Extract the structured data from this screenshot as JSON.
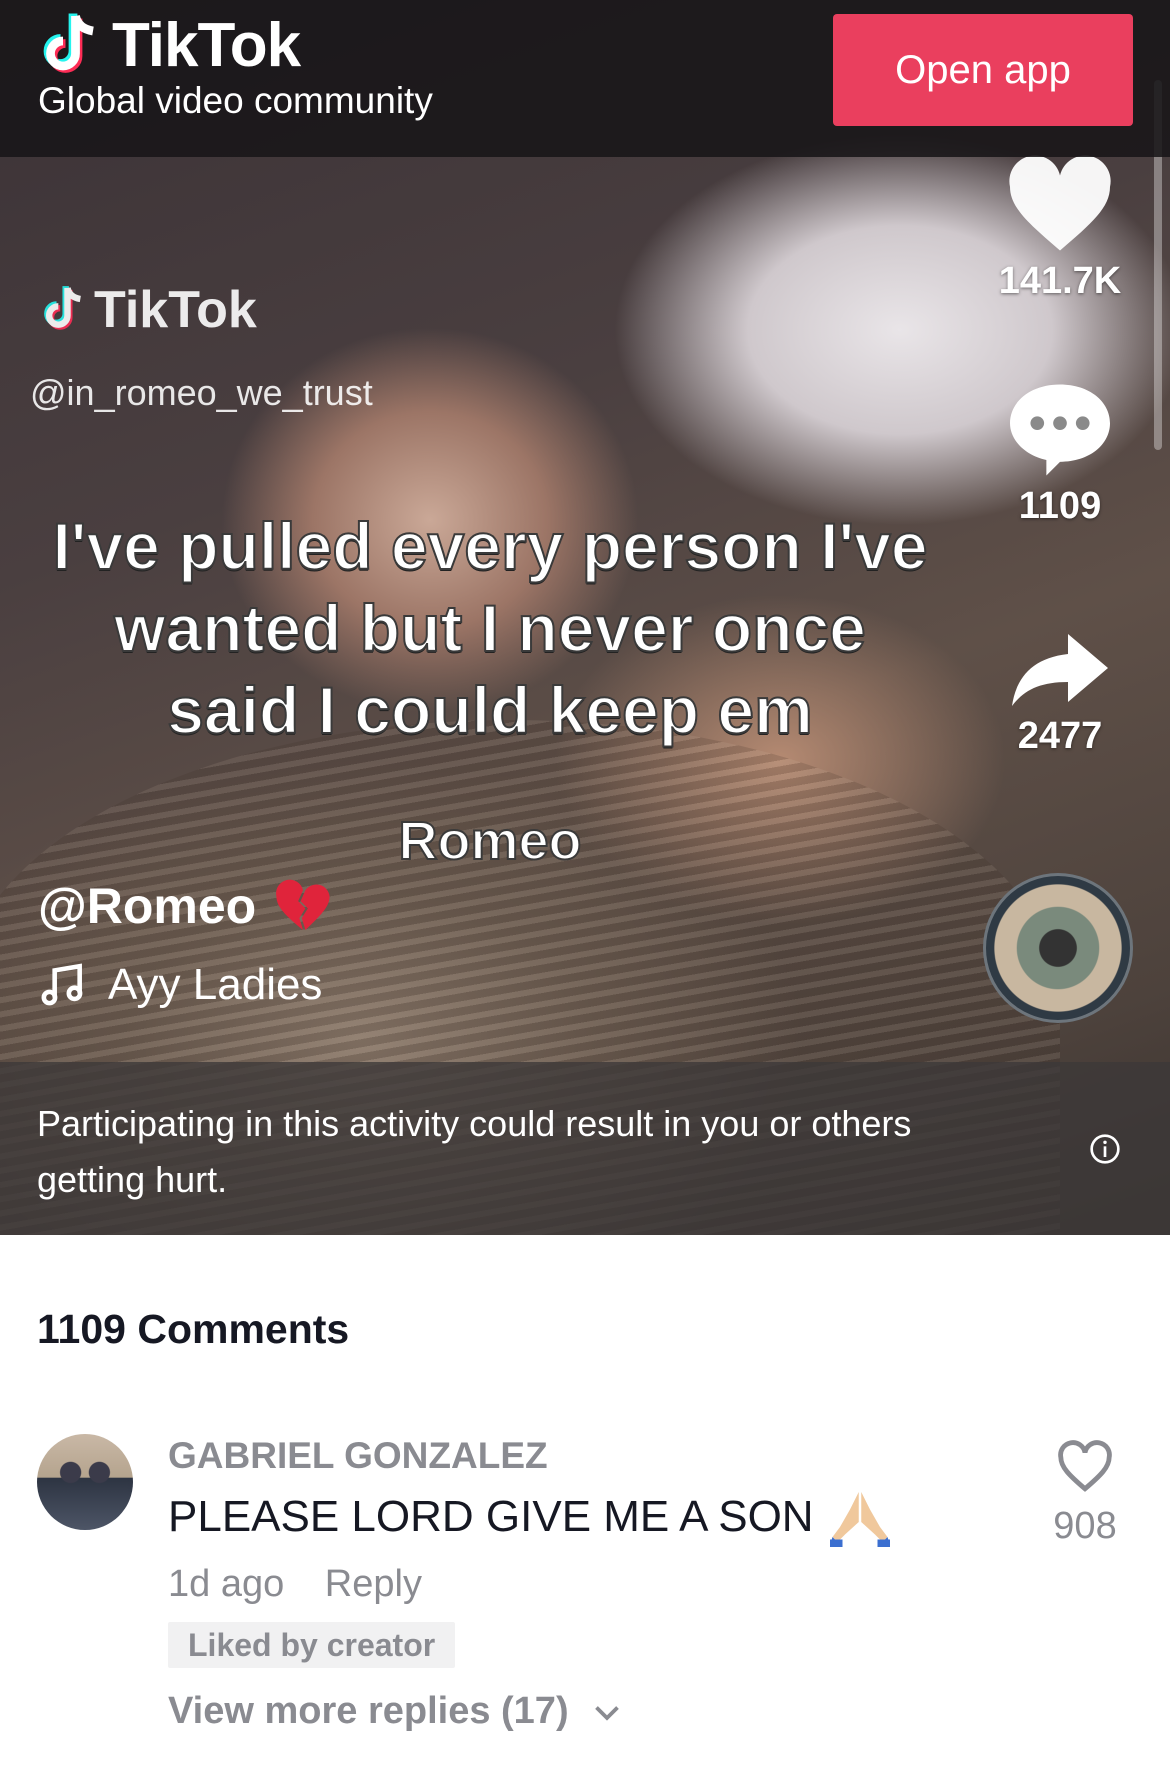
{
  "header": {
    "app_name": "TikTok",
    "tagline": "Global video community",
    "open_app_label": "Open app",
    "accent_color": "#ea3f5e"
  },
  "video": {
    "watermark_brand": "TikTok",
    "watermark_handle": "@in_romeo_we_trust",
    "overlay_text": "I've pulled every person I've wanted but I never once said I could keep em",
    "overlay_signature": "Romeo",
    "author": "@Romeo",
    "author_emoji": "broken-heart-icon",
    "sound_name": "Ayy Ladies",
    "likes": "141.7K",
    "comments": "1109",
    "shares": "2477",
    "warning_text": "Participating in this activity could result in you or others getting hurt."
  },
  "comments_section": {
    "title": "1109 Comments",
    "items": [
      {
        "username": "GABRIEL GONZALEZ",
        "text": "PLEASE LORD GIVE ME A SON",
        "emoji": "praying-hands-icon",
        "time": "1d ago",
        "reply_label": "Reply",
        "badge": "Liked by creator",
        "likes": "908",
        "more_replies": "View more replies (17)"
      }
    ]
  }
}
